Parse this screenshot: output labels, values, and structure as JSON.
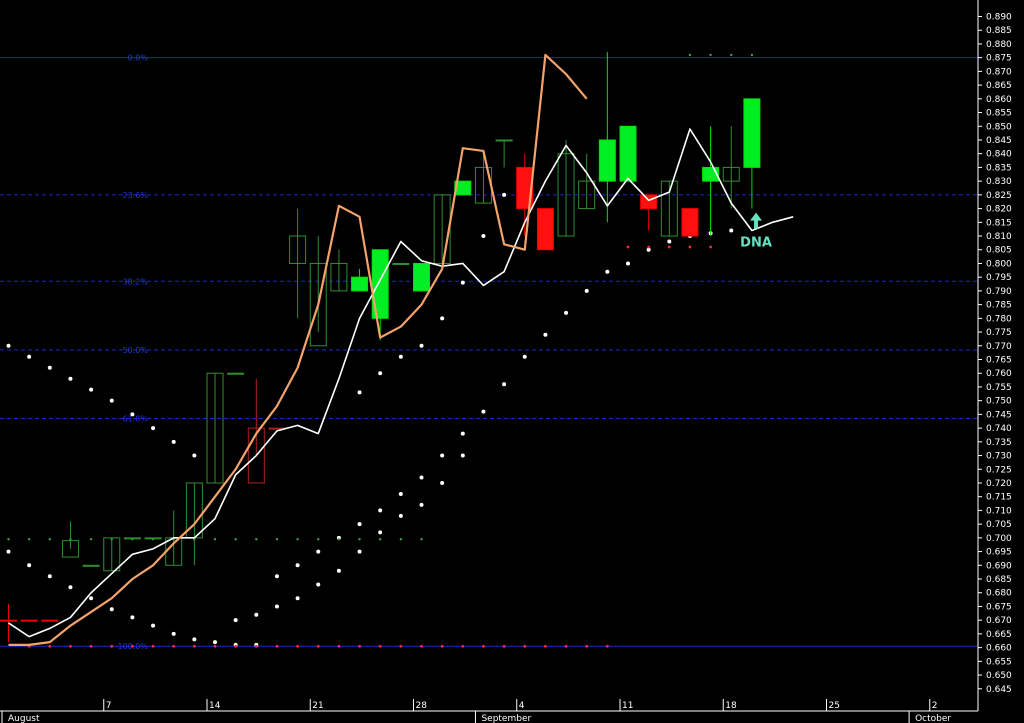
{
  "chart_data": {
    "type": "candlestick",
    "ylim": [
      0.6405,
      0.8955
    ],
    "y_ticks": [
      "0.890",
      "0.885",
      "0.880",
      "0.875",
      "0.870",
      "0.865",
      "0.860",
      "0.855",
      "0.850",
      "0.845",
      "0.840",
      "0.835",
      "0.830",
      "0.825",
      "0.820",
      "0.815",
      "0.810",
      "0.805",
      "0.800",
      "0.795",
      "0.790",
      "0.785",
      "0.780",
      "0.775",
      "0.770",
      "0.765",
      "0.760",
      "0.755",
      "0.750",
      "0.745",
      "0.740",
      "0.735",
      "0.730",
      "0.725",
      "0.720",
      "0.715",
      "0.710",
      "0.705",
      "0.700",
      "0.695",
      "0.690",
      "0.685",
      "0.680",
      "0.675",
      "0.670",
      "0.665",
      "0.660",
      "0.655",
      "0.650",
      "0.645"
    ],
    "x_day_labels": [
      {
        "label": "7",
        "day": 5
      },
      {
        "label": "14",
        "day": 10
      },
      {
        "label": "21",
        "day": 15
      },
      {
        "label": "28",
        "day": 20
      },
      {
        "label": "4",
        "day": 25
      },
      {
        "label": "11",
        "day": 30
      },
      {
        "label": "18",
        "day": 35
      },
      {
        "label": "25",
        "day": 40
      },
      {
        "label": "2",
        "day": 45
      }
    ],
    "x_month_labels": [
      {
        "label": "August",
        "day": 0
      },
      {
        "label": "September",
        "day": 23
      },
      {
        "label": "October",
        "day": 44
      }
    ],
    "fib_levels": [
      {
        "label": "0.0%",
        "value": 0.875
      },
      {
        "label": "23.6%",
        "value": 0.825
      },
      {
        "label": "38.2%",
        "value": 0.7935
      },
      {
        "label": "50.0%",
        "value": 0.7685
      },
      {
        "label": "61.8%",
        "value": 0.7435
      },
      {
        "label": "100.0%",
        "value": 0.6605
      }
    ],
    "candles": [
      {
        "o": 0.67,
        "h": 0.676,
        "l": 0.662,
        "c": 0.67,
        "color": "red"
      },
      {
        "o": 0.67,
        "h": 0.67,
        "l": 0.67,
        "c": 0.67,
        "color": "red"
      },
      {
        "o": 0.67,
        "h": 0.67,
        "l": 0.67,
        "c": 0.67,
        "color": "red"
      },
      {
        "o": 0.699,
        "h": 0.706,
        "l": 0.696,
        "c": 0.693,
        "color": "green_outline"
      },
      {
        "o": 0.69,
        "h": 0.69,
        "l": 0.69,
        "c": 0.69,
        "color": "green_outline"
      },
      {
        "o": 0.688,
        "h": 0.7,
        "l": 0.688,
        "c": 0.7,
        "color": "green_outline"
      },
      {
        "o": 0.7,
        "h": 0.7,
        "l": 0.7,
        "c": 0.7,
        "color": "green_outline"
      },
      {
        "o": 0.7,
        "h": 0.7,
        "l": 0.7,
        "c": 0.7,
        "color": "green_outline"
      },
      {
        "o": 0.69,
        "h": 0.71,
        "l": 0.69,
        "c": 0.7,
        "color": "green_outline"
      },
      {
        "o": 0.7,
        "h": 0.72,
        "l": 0.69,
        "c": 0.72,
        "color": "green_outline"
      },
      {
        "o": 0.72,
        "h": 0.76,
        "l": 0.72,
        "c": 0.76,
        "color": "green_outline"
      },
      {
        "o": 0.76,
        "h": 0.76,
        "l": 0.76,
        "c": 0.76,
        "color": "green_outline"
      },
      {
        "o": 0.74,
        "h": 0.758,
        "l": 0.73,
        "c": 0.72,
        "color": "red_outline"
      },
      {
        "o": 0.74,
        "h": 0.74,
        "l": 0.74,
        "c": 0.74,
        "color": "red_outline"
      },
      {
        "o": 0.8,
        "h": 0.82,
        "l": 0.78,
        "c": 0.81,
        "color": "green_outline"
      },
      {
        "o": 0.8,
        "h": 0.81,
        "l": 0.775,
        "c": 0.77,
        "color": "green_outline"
      },
      {
        "o": 0.79,
        "h": 0.805,
        "l": 0.79,
        "c": 0.8,
        "color": "green_outline"
      },
      {
        "o": 0.79,
        "h": 0.798,
        "l": 0.79,
        "c": 0.795,
        "color": "green"
      },
      {
        "o": 0.78,
        "h": 0.805,
        "l": 0.772,
        "c": 0.805,
        "color": "green"
      },
      {
        "o": 0.8,
        "h": 0.8,
        "l": 0.8,
        "c": 0.8,
        "color": "green_outline"
      },
      {
        "o": 0.79,
        "h": 0.8,
        "l": 0.79,
        "c": 0.8,
        "color": "green"
      },
      {
        "o": 0.8,
        "h": 0.825,
        "l": 0.8,
        "c": 0.825,
        "color": "green_outline"
      },
      {
        "o": 0.825,
        "h": 0.83,
        "l": 0.825,
        "c": 0.83,
        "color": "green"
      },
      {
        "o": 0.822,
        "h": 0.84,
        "l": 0.822,
        "c": 0.835,
        "color": "green_outline"
      },
      {
        "o": 0.845,
        "h": 0.845,
        "l": 0.835,
        "c": 0.845,
        "color": "green_outline"
      },
      {
        "o": 0.835,
        "h": 0.84,
        "l": 0.81,
        "c": 0.82,
        "color": "red"
      },
      {
        "o": 0.82,
        "h": 0.82,
        "l": 0.805,
        "c": 0.805,
        "color": "red"
      },
      {
        "o": 0.81,
        "h": 0.845,
        "l": 0.81,
        "c": 0.84,
        "color": "green_outline"
      },
      {
        "o": 0.82,
        "h": 0.84,
        "l": 0.82,
        "c": 0.83,
        "color": "green_outline"
      },
      {
        "o": 0.83,
        "h": 0.877,
        "l": 0.815,
        "c": 0.845,
        "color": "green"
      },
      {
        "o": 0.83,
        "h": 0.85,
        "l": 0.83,
        "c": 0.85,
        "color": "green"
      },
      {
        "o": 0.825,
        "h": 0.825,
        "l": 0.812,
        "c": 0.82,
        "color": "red"
      },
      {
        "o": 0.81,
        "h": 0.83,
        "l": 0.81,
        "c": 0.83,
        "color": "green_outline"
      },
      {
        "o": 0.82,
        "h": 0.82,
        "l": 0.81,
        "c": 0.81,
        "color": "red"
      },
      {
        "o": 0.83,
        "h": 0.85,
        "l": 0.81,
        "c": 0.835,
        "color": "green"
      },
      {
        "o": 0.83,
        "h": 0.85,
        "l": 0.82,
        "c": 0.835,
        "color": "green_outline"
      },
      {
        "o": 0.835,
        "h": 0.86,
        "l": 0.82,
        "c": 0.86,
        "color": "green"
      }
    ],
    "series": [
      {
        "name": "",
        "color": "#ffffff",
        "values": [
          0.669,
          0.664,
          0.667,
          0.671,
          0.68,
          0.687,
          0.694,
          0.696,
          0.7,
          0.7,
          0.707,
          0.723,
          0.73,
          0.739,
          0.741,
          0.738,
          0.758,
          0.78,
          0.794,
          0.808,
          0.801,
          0.799,
          0.8,
          0.792,
          0.797,
          0.815,
          0.83,
          0.843,
          0.833,
          0.821,
          0.831,
          0.823,
          0.826,
          0.849,
          0.837,
          0.822,
          0.812,
          0.815,
          0.817
        ]
      },
      {
        "name": "",
        "color": "#f4a36a",
        "values": [
          0.661,
          0.661,
          0.662,
          0.668,
          0.673,
          0.678,
          0.685,
          0.69,
          0.698,
          0.705,
          0.715,
          0.725,
          0.738,
          0.748,
          0.762,
          0.785,
          0.821,
          0.817,
          0.773,
          0.777,
          0.785,
          0.798,
          0.842,
          0.841,
          0.807,
          0.805,
          0.876,
          0.869,
          0.86
        ]
      }
    ],
    "psar_dots": [
      {
        "d": 0,
        "v": 0.77
      },
      {
        "d": 1,
        "v": 0.766
      },
      {
        "d": 2,
        "v": 0.762
      },
      {
        "d": 3,
        "v": 0.758
      },
      {
        "d": 4,
        "v": 0.754
      },
      {
        "d": 5,
        "v": 0.75
      },
      {
        "d": 6,
        "v": 0.745
      },
      {
        "d": 7,
        "v": 0.74
      },
      {
        "d": 8,
        "v": 0.735
      },
      {
        "d": 9,
        "v": 0.73
      },
      {
        "d": 0,
        "v": 0.695
      },
      {
        "d": 1,
        "v": 0.69
      },
      {
        "d": 2,
        "v": 0.686
      },
      {
        "d": 3,
        "v": 0.682
      },
      {
        "d": 4,
        "v": 0.678
      },
      {
        "d": 5,
        "v": 0.674
      },
      {
        "d": 6,
        "v": 0.671
      },
      {
        "d": 7,
        "v": 0.668
      },
      {
        "d": 8,
        "v": 0.665
      },
      {
        "d": 9,
        "v": 0.663
      },
      {
        "d": 10,
        "v": 0.662
      },
      {
        "d": 11,
        "v": 0.661
      },
      {
        "d": 12,
        "v": 0.661
      },
      {
        "d": 13,
        "v": 0.686
      },
      {
        "d": 14,
        "v": 0.69
      },
      {
        "d": 15,
        "v": 0.695
      },
      {
        "d": 16,
        "v": 0.7
      },
      {
        "d": 17,
        "v": 0.705
      },
      {
        "d": 18,
        "v": 0.71
      },
      {
        "d": 19,
        "v": 0.716
      },
      {
        "d": 20,
        "v": 0.722
      },
      {
        "d": 21,
        "v": 0.73
      },
      {
        "d": 22,
        "v": 0.738
      },
      {
        "d": 23,
        "v": 0.746
      },
      {
        "d": 24,
        "v": 0.756
      },
      {
        "d": 25,
        "v": 0.766
      },
      {
        "d": 26,
        "v": 0.774
      },
      {
        "d": 27,
        "v": 0.782
      },
      {
        "d": 28,
        "v": 0.79
      },
      {
        "d": 29,
        "v": 0.797
      },
      {
        "d": 30,
        "v": 0.8
      },
      {
        "d": 31,
        "v": 0.805
      },
      {
        "d": 32,
        "v": 0.808
      },
      {
        "d": 33,
        "v": 0.81
      },
      {
        "d": 34,
        "v": 0.811
      },
      {
        "d": 35,
        "v": 0.812
      },
      {
        "d": 11,
        "v": 0.67
      },
      {
        "d": 12,
        "v": 0.672
      },
      {
        "d": 13,
        "v": 0.675
      },
      {
        "d": 14,
        "v": 0.678
      },
      {
        "d": 15,
        "v": 0.683
      },
      {
        "d": 16,
        "v": 0.688
      },
      {
        "d": 17,
        "v": 0.695
      },
      {
        "d": 18,
        "v": 0.702
      },
      {
        "d": 19,
        "v": 0.708
      },
      {
        "d": 20,
        "v": 0.712
      },
      {
        "d": 21,
        "v": 0.72
      },
      {
        "d": 22,
        "v": 0.73
      },
      {
        "d": 17,
        "v": 0.753
      },
      {
        "d": 18,
        "v": 0.76
      },
      {
        "d": 19,
        "v": 0.766
      },
      {
        "d": 20,
        "v": 0.77
      },
      {
        "d": 21,
        "v": 0.78
      },
      {
        "d": 22,
        "v": 0.793
      },
      {
        "d": 23,
        "v": 0.81
      },
      {
        "d": 24,
        "v": 0.825
      }
    ],
    "red_dots": {
      "value": 0.6605,
      "days": [
        1,
        2,
        3,
        4,
        5,
        6,
        7,
        8,
        9,
        10,
        11,
        12,
        13,
        14,
        15,
        16,
        17,
        18,
        19,
        20,
        21,
        22,
        23,
        24,
        25,
        26,
        27,
        28,
        29
      ]
    },
    "red_dots_2": {
      "value": 0.806,
      "days": [
        30,
        31,
        32,
        33,
        34
      ]
    },
    "green_dots_upper": {
      "value": 0.876,
      "days": [
        33,
        34,
        35,
        36
      ]
    },
    "green_dots_mid": {
      "value": 0.6995,
      "days": [
        0,
        1,
        2,
        3,
        4,
        5,
        6,
        7,
        8,
        9,
        10,
        11,
        12,
        13,
        14,
        15,
        16,
        17,
        18,
        19,
        20
      ]
    },
    "annotation": {
      "text": "DNA",
      "day": 36.2,
      "value": 0.8105,
      "color": "#66e0c0"
    }
  }
}
